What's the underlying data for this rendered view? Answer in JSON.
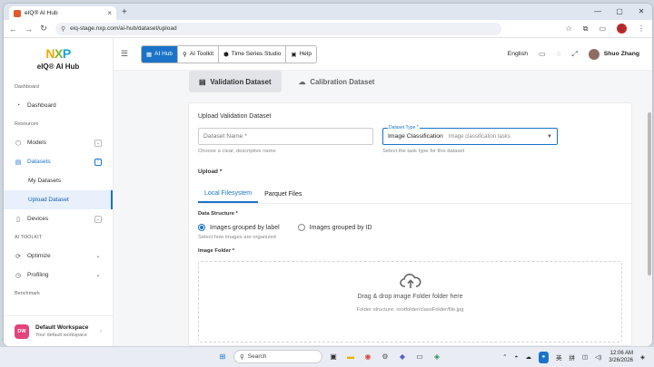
{
  "browser": {
    "tab_title": "eIQ® AI Hub",
    "tab_close": "×",
    "new_tab": "+",
    "url": "eiq-stage.nxp.com/ai-hub/dataset/upload",
    "window_controls": [
      "—",
      "▢",
      "✕"
    ],
    "profile_initial": "C"
  },
  "sidebar": {
    "logo_n": "N",
    "logo_x": "X",
    "logo_p": "P",
    "app_name": "eIQ® AI Hub",
    "section_dashboard": "Dashboard",
    "section_resources": "Resources",
    "section_toolkit": "AI TOOLKIT",
    "section_benchmark": "Benchmark",
    "items": {
      "dashboard": "Dashboard",
      "models": "Models",
      "datasets": "Datasets",
      "my_datasets": "My Datasets",
      "upload_dataset": "Upload Dataset",
      "devices": "Devices",
      "optimize": "Optimize",
      "profiling": "Profiling"
    },
    "workspace": {
      "initials": "DW",
      "name": "Default Workspace",
      "sub": "Your default workspace"
    }
  },
  "topnav": {
    "menu_icon": "☰",
    "segments": [
      "AI Hub",
      "AI Toolkit",
      "Time Series Studio",
      "Help"
    ],
    "language": "English",
    "user_name": "Shuo Zhang"
  },
  "main": {
    "tabs": [
      "Validation Dataset",
      "Calibration Dataset"
    ],
    "form_title": "Upload Validation Dataset",
    "dataset_name_placeholder": "Dataset Name *",
    "dataset_name_help": "Choose a clear, descriptive name",
    "dataset_type_label": "Dataset Type *",
    "dataset_type_value": "Image Classification",
    "dataset_type_hint": "Image classification tasks",
    "dataset_type_help": "Select the task type for this dataset",
    "upload_label": "Upload *",
    "file_tabs": [
      "Local Filesystem",
      "Parquet Files"
    ],
    "data_structure_label": "Data Structure *",
    "radio_label": "Images grouped by label",
    "radio_id": "Images grouped by ID",
    "radio_help": "Select how images are organized",
    "image_folder_label": "Image Folder *",
    "drop_title": "Drag & drop image Folder folder here",
    "drop_sub": "Folder structure: rootfolder/classFolder/file.jpg"
  },
  "taskbar": {
    "search": "Search",
    "ime_lang": "英",
    "ime_mode": "拼",
    "time": "12:06 AM",
    "date": "3/26/2026"
  }
}
